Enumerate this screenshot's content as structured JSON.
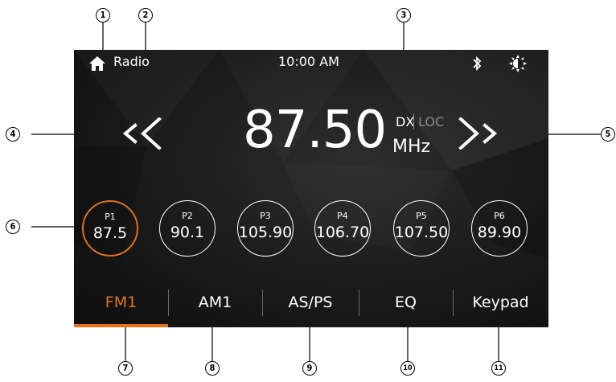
{
  "status_bar": {
    "home_icon": "home-icon",
    "source_label": "Radio",
    "time": "10:00 AM",
    "bluetooth_icon": "bluetooth-icon",
    "brightness_icon": "brightness-icon"
  },
  "tuner": {
    "frequency": "87.50",
    "unit": "MHz",
    "mode_dx": "DX",
    "mode_loc": "LOC",
    "seek_back_icon": "seek-back-icon",
    "seek_forward_icon": "seek-forward-icon"
  },
  "presets": [
    {
      "label": "P1",
      "value": "87.5",
      "active": true
    },
    {
      "label": "P2",
      "value": "90.1"
    },
    {
      "label": "P3",
      "value": "105.90"
    },
    {
      "label": "P4",
      "value": "106.70"
    },
    {
      "label": "P5",
      "value": "107.50"
    },
    {
      "label": "P6",
      "value": "89.90"
    }
  ],
  "tabs": [
    {
      "label": "FM1",
      "active": true
    },
    {
      "label": "AM1"
    },
    {
      "label": "AS/PS"
    },
    {
      "label": "EQ"
    },
    {
      "label": "Keypad"
    }
  ],
  "colors": {
    "accent": "#e0731c",
    "background": "#1a1a1a",
    "text": "#ffffff",
    "inactive_text": "#8a8a8a"
  },
  "callouts": [
    "1",
    "2",
    "3",
    "4",
    "5",
    "6",
    "7",
    "8",
    "9",
    "10",
    "11"
  ]
}
